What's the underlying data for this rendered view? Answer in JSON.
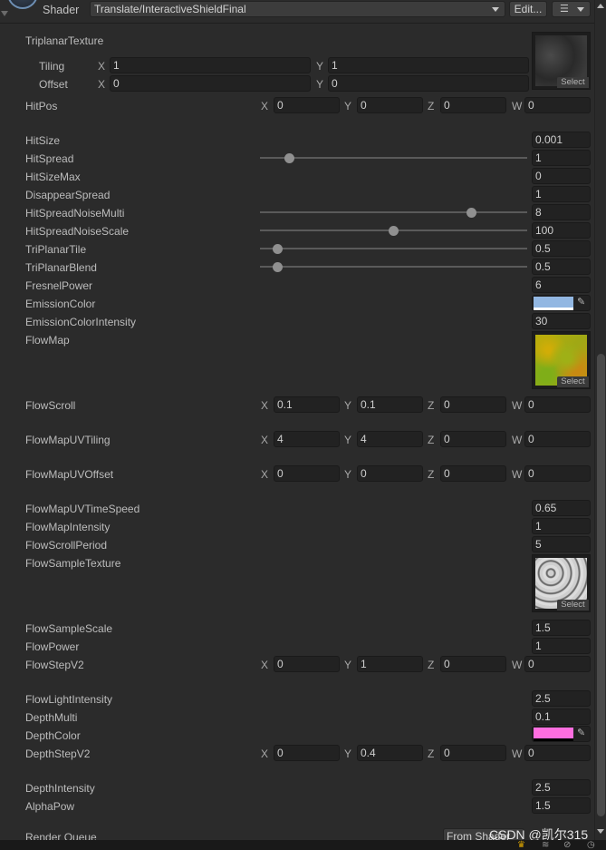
{
  "header": {
    "shader_label": "Shader",
    "shader_value": "Translate/InteractiveShieldFinal",
    "edit_label": "Edit...",
    "menu_icon": "list-icon"
  },
  "triplanar_texture": {
    "label": "TriplanarTexture",
    "tiling_label": "Tiling",
    "offset_label": "Offset",
    "tiling": {
      "x": "1",
      "y": "1"
    },
    "offset": {
      "x": "0",
      "y": "0"
    },
    "select_label": "Select"
  },
  "axes": {
    "x": "X",
    "y": "Y",
    "z": "Z",
    "w": "W"
  },
  "hit_pos": {
    "label": "HitPos",
    "x": "0",
    "y": "0",
    "z": "0",
    "w": "0"
  },
  "floats_1": [
    {
      "label": "HitSize",
      "value": "0.001"
    },
    {
      "label": "HitSpread",
      "value": "1",
      "slider_fraction": 0.11
    },
    {
      "label": "HitSizeMax",
      "value": "0"
    },
    {
      "label": "DisappearSpread",
      "value": "1"
    },
    {
      "label": "HitSpreadNoiseMulti",
      "value": "8",
      "slider_fraction": 0.79
    },
    {
      "label": "HitSpreadNoiseScale",
      "value": "100",
      "slider_fraction": 0.5
    },
    {
      "label": "TriPlanarTile",
      "value": "0.5",
      "slider_fraction": 0.065
    },
    {
      "label": "TriPlanarBlend",
      "value": "0.5",
      "slider_fraction": 0.065
    },
    {
      "label": "FresnelPower",
      "value": "6"
    }
  ],
  "emission_color": {
    "label": "EmissionColor",
    "color": "#92b7e2",
    "alpha_color": "#ffffff"
  },
  "emission_intensity": {
    "label": "EmissionColorIntensity",
    "value": "30"
  },
  "flow_map": {
    "label": "FlowMap",
    "select_label": "Select"
  },
  "flow_scroll": {
    "label": "FlowScroll",
    "x": "0.1",
    "y": "0.1",
    "z": "0",
    "w": "0"
  },
  "flow_map_uv_tiling": {
    "label": "FlowMapUVTiling",
    "x": "4",
    "y": "4",
    "z": "0",
    "w": "0"
  },
  "flow_map_uv_offset": {
    "label": "FlowMapUVOffset",
    "x": "0",
    "y": "0",
    "z": "0",
    "w": "0"
  },
  "floats_2": [
    {
      "label": "FlowMapUVTimeSpeed",
      "value": "0.65"
    },
    {
      "label": "FlowMapIntensity",
      "value": "1"
    },
    {
      "label": "FlowScrollPeriod",
      "value": "5"
    }
  ],
  "flow_sample_texture": {
    "label": "FlowSampleTexture",
    "select_label": "Select"
  },
  "floats_3": [
    {
      "label": "FlowSampleScale",
      "value": "1.5"
    },
    {
      "label": "FlowPower",
      "value": "1"
    }
  ],
  "flow_step_v2": {
    "label": "FlowStepV2",
    "x": "0",
    "y": "1",
    "z": "0",
    "w": "0"
  },
  "floats_4": [
    {
      "label": "FlowLightIntensity",
      "value": "2.5"
    },
    {
      "label": "DepthMulti",
      "value": "0.1"
    }
  ],
  "depth_color": {
    "label": "DepthColor",
    "color": "#ff6ee0",
    "alpha_color": "#000000"
  },
  "depth_step_v2": {
    "label": "DepthStepV2",
    "x": "0",
    "y": "0.4",
    "z": "0",
    "w": "0"
  },
  "floats_5": [
    {
      "label": "DepthIntensity",
      "value": "2.5"
    },
    {
      "label": "AlphaPow",
      "value": "1.5"
    }
  ],
  "render_queue": {
    "label": "Render Queue",
    "value": "From Shader"
  },
  "watermark": "CSDN @凯尔315"
}
